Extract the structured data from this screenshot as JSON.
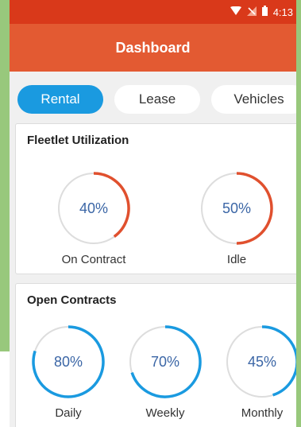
{
  "status": {
    "time": "4:13"
  },
  "appbar": {
    "title": "Dashboard"
  },
  "tabs": [
    {
      "label": "Rental",
      "active": true
    },
    {
      "label": "Lease",
      "active": false
    },
    {
      "label": "Vehicles",
      "active": false
    }
  ],
  "utilization": {
    "title": "Fleetlet Utilization",
    "color": "#e0502e",
    "items": [
      {
        "label": "On Contract",
        "percent_text": "40%",
        "percent": 40
      },
      {
        "label": "Idle",
        "percent_text": "50%",
        "percent": 50
      }
    ]
  },
  "contracts": {
    "title": "Open Contracts",
    "color": "#1a9ae0",
    "items": [
      {
        "label": "Daily",
        "percent_text": "80%",
        "percent": 80
      },
      {
        "label": "Weekly",
        "percent_text": "70%",
        "percent": 70
      },
      {
        "label": "Monthly",
        "percent_text": "45%",
        "percent": 45
      }
    ]
  },
  "colors": {
    "statusbar": "#d9391a",
    "appbar": "#e35a32",
    "accent": "#1a9ae0"
  }
}
